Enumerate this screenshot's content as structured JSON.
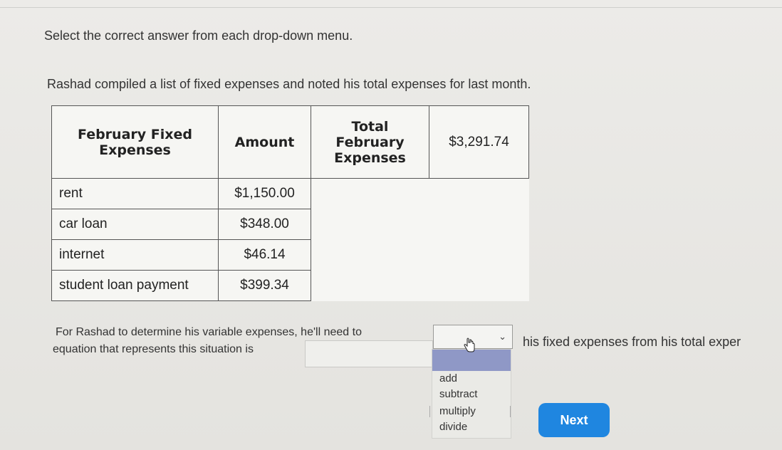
{
  "instruction": "Select the correct answer from each drop-down menu.",
  "prompt": "Rashad compiled a list of fixed expenses and noted his total expenses for last month.",
  "table": {
    "headers": {
      "name": "February Fixed Expenses",
      "amount": "Amount",
      "total_label": "Total February Expenses",
      "total_value": "$3,291.74"
    },
    "rows": [
      {
        "name": "rent",
        "amount": "$1,150.00"
      },
      {
        "name": "car loan",
        "amount": "$348.00"
      },
      {
        "name": "internet",
        "amount": "$46.14"
      },
      {
        "name": "student loan payment",
        "amount": "$399.34"
      }
    ]
  },
  "question": {
    "line1": "For Rashad to determine his variable expenses, he'll need to",
    "line1_continuation": "his fixed expenses from his total exper",
    "line2": "equation that represents this situation is"
  },
  "dropdown": {
    "selected": "",
    "options": [
      "add",
      "subtract",
      "multiply",
      "divide"
    ]
  },
  "next_button": "Next",
  "colors": {
    "next_button_bg": "#1f86e0",
    "dropdown_highlight": "#8f98c6"
  }
}
